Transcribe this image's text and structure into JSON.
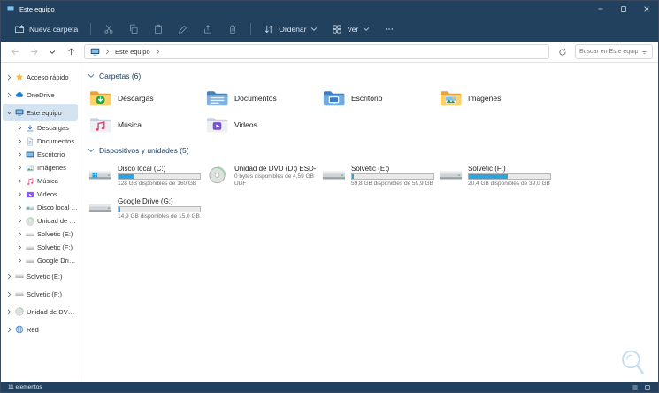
{
  "window": {
    "title": "Este equipo",
    "status_count": "11 elementos"
  },
  "toolbar": {
    "new_folder_label": "Nueva carpeta",
    "sort_label": "Ordenar",
    "view_label": "Ver"
  },
  "addressbar": {
    "location": "Este equipo",
    "search_placeholder": "Buscar en Este equipo"
  },
  "icons": {
    "window": "computer-icon",
    "new_folder": "folder-plus-icon",
    "cut": "scissors-icon",
    "copy": "copy-icon",
    "paste": "clipboard-icon",
    "rename": "pencil-icon",
    "share": "share-icon",
    "delete": "trash-icon",
    "sort": "sort-arrows-icon",
    "view": "grid-icon",
    "more": "ellipsis-icon",
    "back": "arrow-left-icon",
    "forward": "arrow-right-icon",
    "recent": "chevron-down-icon",
    "up": "arrow-up-icon",
    "refresh": "refresh-icon",
    "search_filter": "filter-icon"
  },
  "sidebar": {
    "items": [
      {
        "label": "Acceso rápido",
        "icon": "star",
        "level": 0
      },
      {
        "label": "OneDrive",
        "icon": "cloud",
        "level": 0
      },
      {
        "label": "Este equipo",
        "icon": "computer",
        "level": 0,
        "selected": true
      },
      {
        "label": "Descargas",
        "icon": "download",
        "level": 1
      },
      {
        "label": "Documentos",
        "icon": "document",
        "level": 1
      },
      {
        "label": "Escritorio",
        "icon": "monitor",
        "level": 1
      },
      {
        "label": "Imágenes",
        "icon": "picture",
        "level": 1
      },
      {
        "label": "Música",
        "icon": "music",
        "level": 1
      },
      {
        "label": "Videos",
        "icon": "video",
        "level": 1
      },
      {
        "label": "Disco local (C:)",
        "icon": "drive-windows",
        "level": 1
      },
      {
        "label": "Unidad de DVD (D:)",
        "icon": "dvd",
        "level": 1
      },
      {
        "label": "Solvetic (E:)",
        "icon": "drive",
        "level": 1
      },
      {
        "label": "Solvetic (F:)",
        "icon": "drive",
        "level": 1
      },
      {
        "label": "Google Drive (G:)",
        "icon": "drive",
        "level": 1
      },
      {
        "label": "Solvetic (E:)",
        "icon": "drive",
        "level": 0
      },
      {
        "label": "Solvetic (F:)",
        "icon": "drive",
        "level": 0
      },
      {
        "label": "Unidad de DVD (D:)",
        "icon": "dvd",
        "level": 0
      },
      {
        "label": "Red",
        "icon": "network",
        "level": 0
      }
    ]
  },
  "sections": {
    "folders": {
      "title": "Carpetas (6)",
      "items": [
        {
          "name": "Descargas",
          "icon": "folder-download"
        },
        {
          "name": "Documentos",
          "icon": "folder-documents"
        },
        {
          "name": "Escritorio",
          "icon": "folder-desktop"
        },
        {
          "name": "Imágenes",
          "icon": "folder-pictures"
        },
        {
          "name": "Música",
          "icon": "folder-music"
        },
        {
          "name": "Videos",
          "icon": "folder-videos"
        }
      ]
    },
    "drives": {
      "title": "Dispositivos y unidades (5)",
      "items": [
        {
          "name": "Disco local (C:)",
          "detail": "128 GB disponibles de 160 GB",
          "used_pct": 20,
          "icon": "drive-windows"
        },
        {
          "name": "Unidad de DVD (D:) ESD-ISO",
          "detail": "0 bytes disponibles de 4,59 GB",
          "extra": "UDF",
          "icon": "dvd"
        },
        {
          "name": "Solvetic (E:)",
          "detail": "59,8 GB disponibles de 59,9 GB",
          "used_pct": 2,
          "icon": "drive"
        },
        {
          "name": "Solvetic (F:)",
          "detail": "20,4 GB disponibles de 39,0 GB",
          "used_pct": 48,
          "icon": "drive"
        },
        {
          "name": "Google Drive (G:)",
          "detail": "14,9 GB disponibles de 15,0 GB",
          "used_pct": 2,
          "icon": "drive"
        }
      ]
    }
  }
}
